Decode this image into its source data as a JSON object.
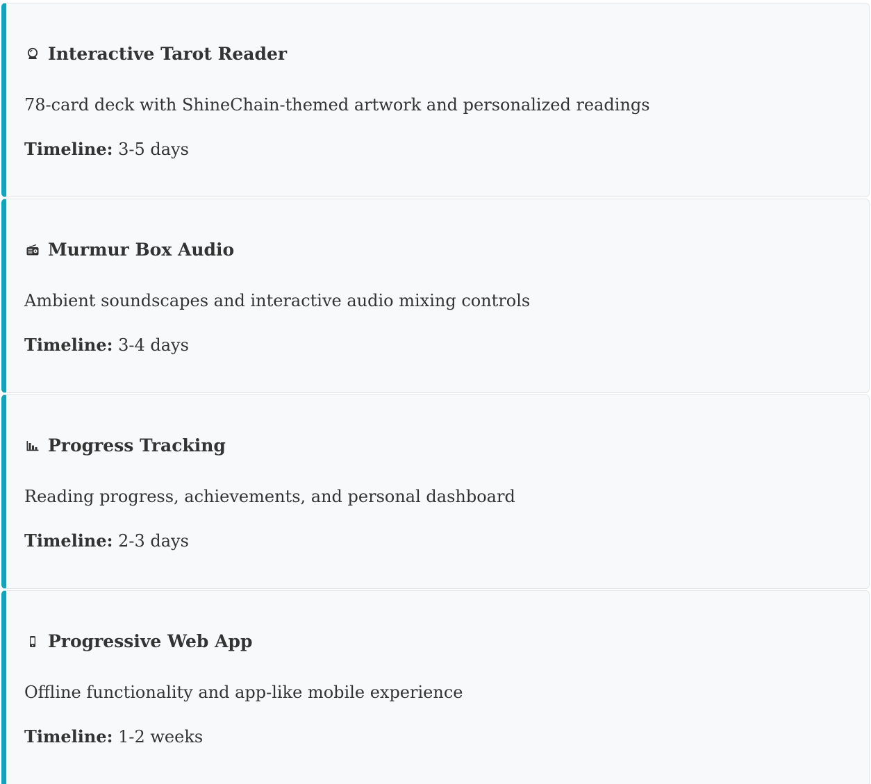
{
  "features": [
    {
      "icon": "crystal-ball-icon",
      "title": "Interactive Tarot Reader",
      "description": "78-card deck with ShineChain-themed artwork and personalized readings",
      "timeline_label": "Timeline:",
      "timeline_value": "3-5 days"
    },
    {
      "icon": "radio-icon",
      "title": "Murmur Box Audio",
      "description": "Ambient soundscapes and interactive audio mixing controls",
      "timeline_label": "Timeline:",
      "timeline_value": "3-4 days"
    },
    {
      "icon": "bar-chart-icon",
      "title": "Progress Tracking",
      "description": "Reading progress, achievements, and personal dashboard",
      "timeline_label": "Timeline:",
      "timeline_value": "2-3 days"
    },
    {
      "icon": "mobile-phone-icon",
      "title": "Progressive Web App",
      "description": "Offline functionality and app-like mobile experience",
      "timeline_label": "Timeline:",
      "timeline_value": "1-2 weeks"
    }
  ],
  "colors": {
    "accent": "#17a2b8",
    "card_background": "#f8f9fa",
    "text": "#333333"
  }
}
